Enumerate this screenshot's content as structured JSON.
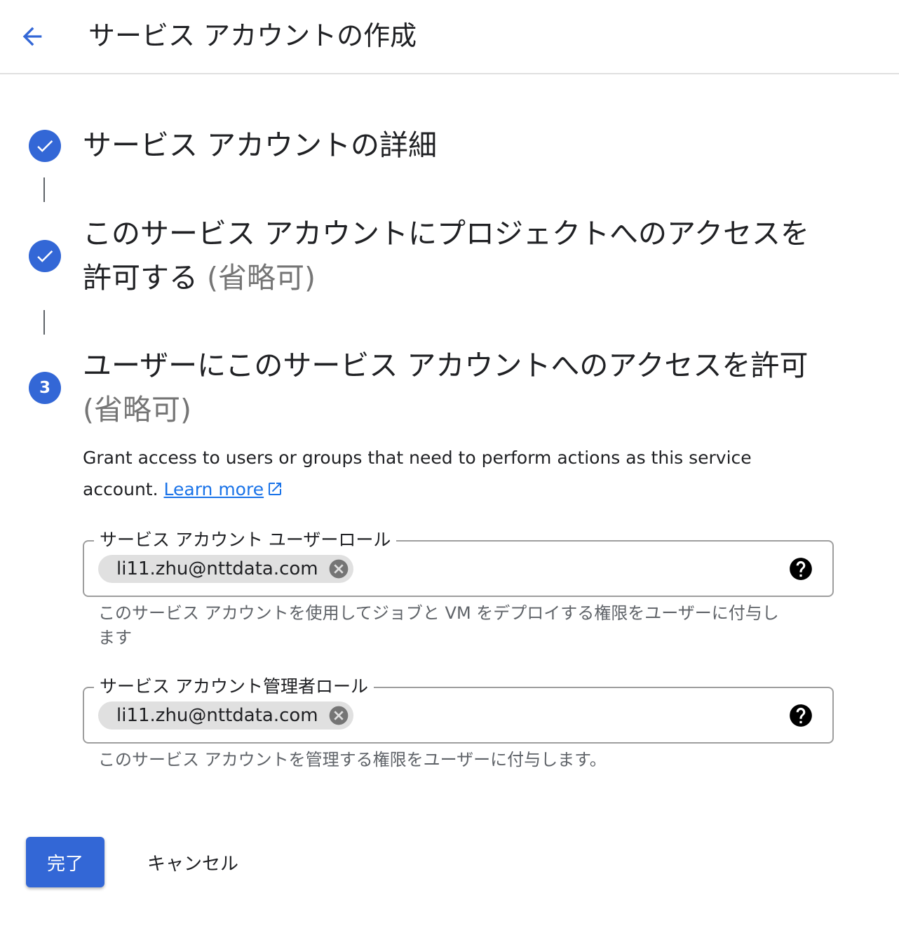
{
  "header": {
    "title": "サービス アカウントの作成"
  },
  "steps": [
    {
      "status": "complete",
      "title": "サービス アカウントの詳細",
      "optional": ""
    },
    {
      "status": "complete",
      "title": "このサービス アカウントにプロジェクトへのアクセスを許可する",
      "optional": "(省略可)"
    },
    {
      "status": "active",
      "number": "3",
      "title": "ユーザーにこのサービス アカウントへのアクセスを許可",
      "optional": "(省略可)"
    }
  ],
  "description": {
    "text": "Grant access to users or groups that need to perform actions as this service account.",
    "link_label": "Learn more"
  },
  "fields": [
    {
      "label": "サービス アカウント ユーザーロール",
      "chip": "li11.zhu@nttdata.com",
      "helper": "このサービス アカウントを使用してジョブと VM をデプロイする権限をユーザーに付与します"
    },
    {
      "label": "サービス アカウント管理者ロール",
      "chip": "li11.zhu@nttdata.com",
      "helper": "このサービス アカウントを管理する権限をユーザーに付与します。"
    }
  ],
  "actions": {
    "done_label": "完了",
    "cancel_label": "キャンセル"
  },
  "colors": {
    "accent": "#3367d6",
    "link": "#1a73e8",
    "chip": "#e0e0e0",
    "border": "#9e9e9e"
  },
  "icons": {
    "back": "arrow-back-icon",
    "check": "check-icon",
    "external": "open-in-new-icon",
    "remove": "cancel-icon",
    "help": "help-icon"
  }
}
